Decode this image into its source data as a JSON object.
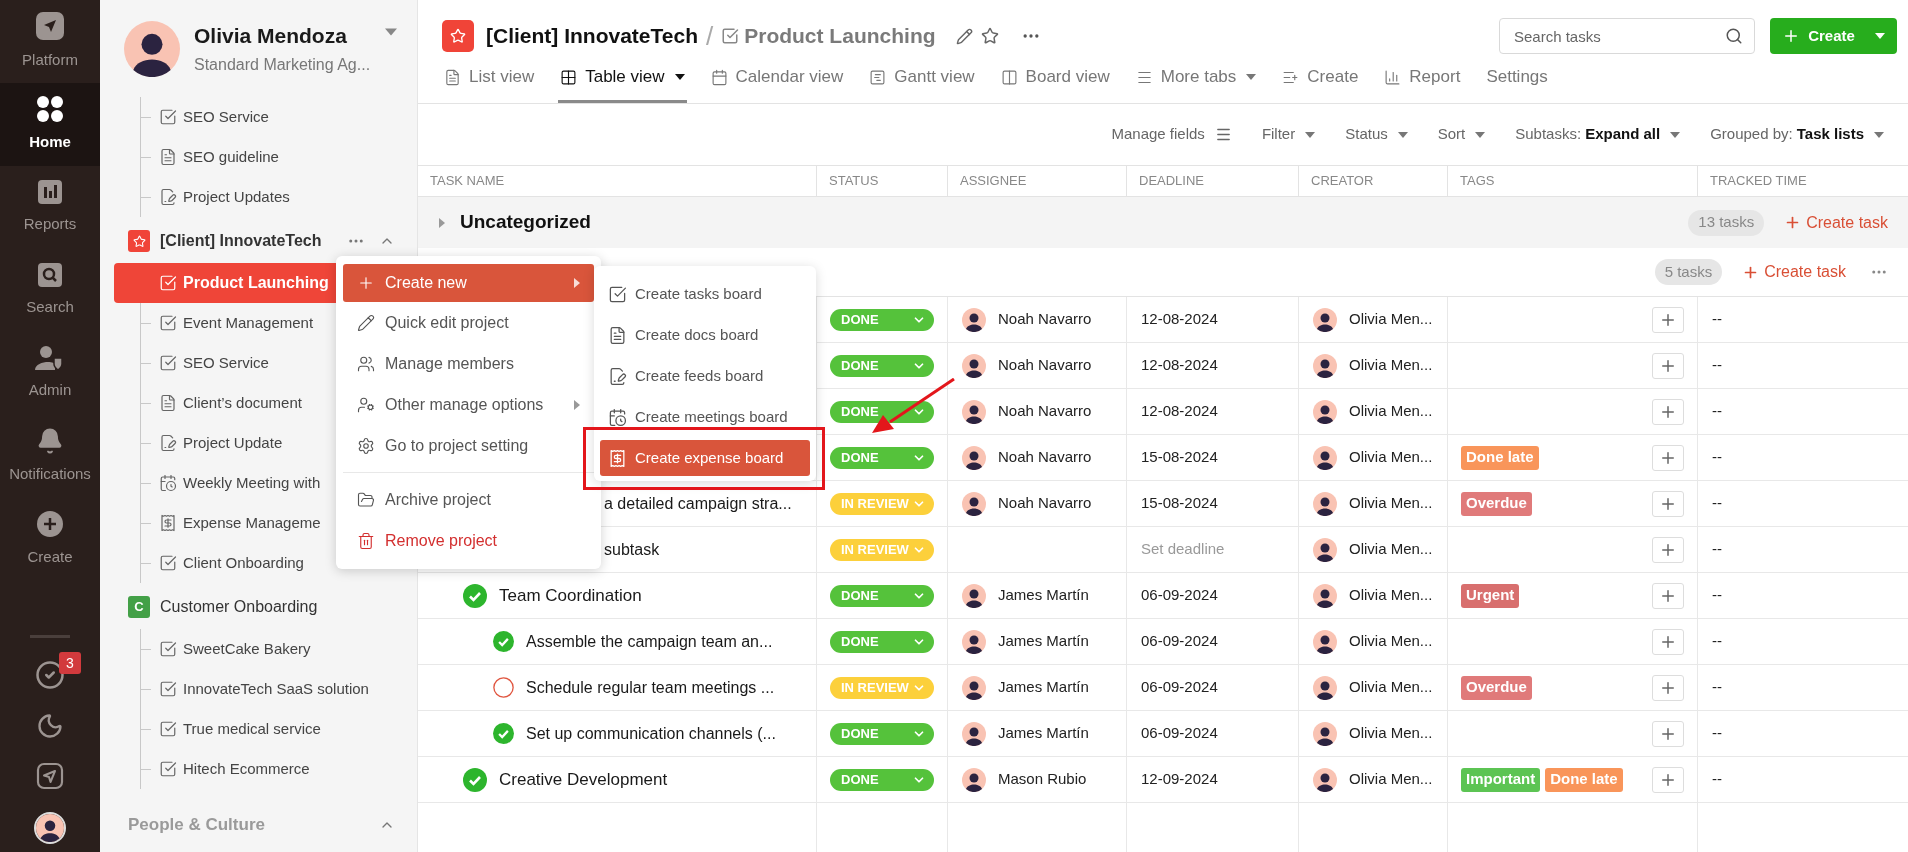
{
  "rail": {
    "items": [
      {
        "label": "Platform",
        "kind": "platform",
        "selected": false
      },
      {
        "label": "Home",
        "kind": "home",
        "selected": true
      },
      {
        "label": "Reports",
        "kind": "reports",
        "selected": false
      },
      {
        "label": "Search",
        "kind": "search",
        "selected": false
      },
      {
        "label": "Admin",
        "kind": "admin",
        "selected": false
      },
      {
        "label": "Notifications",
        "kind": "notifications",
        "selected": false
      },
      {
        "label": "Create",
        "kind": "create",
        "selected": false
      }
    ],
    "tools": [
      {
        "kind": "tasks",
        "badge": "3"
      },
      {
        "kind": "theme"
      },
      {
        "kind": "platform"
      },
      {
        "kind": "avatar"
      }
    ]
  },
  "sidebar": {
    "user": {
      "name": "Olivia Mendoza",
      "subtitle": "Standard Marketing Ag..."
    },
    "groups": [
      {
        "kind": "continued",
        "items": [
          {
            "label": "SEO Service",
            "kind": "tasks",
            "selected": false
          },
          {
            "label": "SEO guideline",
            "kind": "docs",
            "selected": false
          },
          {
            "label": "Project Updates",
            "kind": "feeds",
            "selected": false
          }
        ]
      },
      {
        "kind": "project",
        "name": "[Client] InnovateTech",
        "color": "#f04438",
        "expanded": true,
        "hovered": true,
        "items": [
          {
            "label": "Product Launching",
            "kind": "tasks",
            "selected": true
          },
          {
            "label": "Event Management",
            "kind": "tasks",
            "selected": false
          },
          {
            "label": "SEO Service",
            "kind": "tasks",
            "selected": false
          },
          {
            "label": "Client’s document",
            "kind": "docs",
            "selected": false
          },
          {
            "label": "Project Update",
            "kind": "feeds",
            "selected": false
          },
          {
            "label": "Weekly Meeting with",
            "kind": "meetings",
            "selected": false
          },
          {
            "label": "Expense Manageme",
            "kind": "expense",
            "selected": false
          },
          {
            "label": "Client Onboarding",
            "kind": "tasks",
            "selected": false
          }
        ]
      },
      {
        "kind": "project",
        "name": "Customer Onboarding",
        "letter": "C",
        "color": "#43a047",
        "items": [
          {
            "label": "SweetCake Bakery",
            "kind": "tasks",
            "selected": false
          },
          {
            "label": "InnovateTech SaaS solution",
            "kind": "tasks",
            "selected": false
          },
          {
            "label": "True medical service",
            "kind": "tasks",
            "selected": false
          },
          {
            "label": "Hitech Ecommerce",
            "kind": "tasks",
            "selected": false
          }
        ]
      },
      {
        "kind": "section",
        "name": "People & Culture",
        "expanded": true
      }
    ]
  },
  "header": {
    "project": "[Client] InnovateTech",
    "separator": "/",
    "board": "Product Launching",
    "tabs": [
      {
        "label": "List view",
        "kind": "list",
        "selected": false
      },
      {
        "label": "Table view",
        "kind": "table",
        "selected": true,
        "dropdown": true
      },
      {
        "label": "Calendar view",
        "kind": "calendar",
        "selected": false
      },
      {
        "label": "Gantt view",
        "kind": "gantt",
        "selected": false
      },
      {
        "label": "Board view",
        "kind": "board",
        "selected": false
      },
      {
        "label": "More tabs",
        "kind": "more",
        "selected": false,
        "dropdown": true
      },
      {
        "label": "Create",
        "kind": "create",
        "selected": false
      },
      {
        "label": "Report",
        "kind": "report",
        "selected": false
      },
      {
        "label": "Settings",
        "kind": "settings",
        "selected": false
      }
    ],
    "search": {
      "placeholder": "Search tasks"
    },
    "create_button": "Create"
  },
  "toolbar": [
    {
      "label": "Manage fields",
      "kind": "fields"
    },
    {
      "label": "Filter",
      "kind": "dropdown"
    },
    {
      "label": "Status",
      "kind": "dropdown"
    },
    {
      "label": "Sort",
      "kind": "dropdown"
    },
    {
      "label": "Subtasks:",
      "value": "Expand all",
      "kind": "dropdown"
    },
    {
      "label": "Grouped by:",
      "value": "Task lists",
      "kind": "dropdown"
    }
  ],
  "table": {
    "columns": [
      "TASK NAME",
      "STATUS",
      "ASSIGNEE",
      "DEADLINE",
      "CREATOR",
      "TAGS",
      "TRACKED TIME"
    ],
    "groups": [
      {
        "name": "Uncategorized",
        "expanded": false,
        "count": "13 tasks",
        "action": "Create task"
      },
      {
        "count": "5 tasks",
        "action": "Create task",
        "rows": [
          {
            "status": {
              "label": "DONE",
              "kind": "done"
            },
            "assignee": "Noah Navarro",
            "deadline": "12-08-2024",
            "creator": "Olivia Men...",
            "tracked": "--"
          },
          {
            "status": {
              "label": "DONE",
              "kind": "done"
            },
            "assignee": "Noah Navarro",
            "deadline": "12-08-2024",
            "creator": "Olivia Men...",
            "tracked": "--"
          },
          {
            "status": {
              "label": "DONE",
              "kind": "done"
            },
            "assignee": "Noah Navarro",
            "deadline": "12-08-2024",
            "creator": "Olivia Men...",
            "tracked": "--"
          },
          {
            "status": {
              "label": "DONE",
              "kind": "done"
            },
            "assignee": "Noah Navarro",
            "deadline": "15-08-2024",
            "creator": "Olivia Men...",
            "tags": [
              {
                "label": "Done late",
                "color": "#f9955a"
              }
            ],
            "tracked": "--"
          },
          {
            "name": "a detailed campaign stra...",
            "status": {
              "label": "IN REVIEW",
              "kind": "in_review"
            },
            "assignee": "Noah Navarro",
            "deadline": "15-08-2024",
            "creator": "Olivia Men...",
            "tags": [
              {
                "label": "Overdue",
                "color": "#e07a7a"
              }
            ],
            "tracked": "--"
          },
          {
            "name": "subtask",
            "status": {
              "label": "IN REVIEW",
              "kind": "in_review"
            },
            "deadline_placeholder": "Set deadline",
            "creator": "Olivia Men...",
            "tracked": "--"
          },
          {
            "name": "Team Coordination",
            "done": true,
            "status": {
              "label": "DONE",
              "kind": "done"
            },
            "assignee": "James Martín",
            "deadline": "06-09-2024",
            "creator": "Olivia Men...",
            "tags": [
              {
                "label": "Urgent",
                "color": "#d86f6e"
              }
            ],
            "tracked": "--",
            "children": [
              {
                "name": "Assemble the campaign team an...",
                "done": true,
                "status": {
                  "label": "DONE",
                  "kind": "done"
                },
                "assignee": "James Martín",
                "deadline": "06-09-2024",
                "creator": "Olivia Men...",
                "tracked": "--"
              },
              {
                "name": "Schedule regular team meetings ...",
                "done": false,
                "status": {
                  "label": "IN REVIEW",
                  "kind": "in_review"
                },
                "assignee": "James Martín",
                "deadline": "06-09-2024",
                "creator": "Olivia Men...",
                "tags": [
                  {
                    "label": "Overdue",
                    "color": "#e07a7a"
                  }
                ],
                "tracked": "--"
              },
              {
                "name": "Set up communication channels (...",
                "done": true,
                "status": {
                  "label": "DONE",
                  "kind": "done"
                },
                "assignee": "James Martín",
                "deadline": "06-09-2024",
                "creator": "Olivia Men...",
                "tracked": "--"
              }
            ]
          },
          {
            "name": "Creative Development",
            "done": true,
            "status": {
              "label": "DONE",
              "kind": "done"
            },
            "assignee": "Mason Rubio",
            "deadline": "12-09-2024",
            "creator": "Olivia Men...",
            "tags": [
              {
                "label": "Important",
                "color": "#5cc453"
              },
              {
                "label": "Done late",
                "color": "#f9955a"
              }
            ],
            "tracked": "--"
          }
        ]
      }
    ]
  },
  "context_menu": {
    "groups": [
      [
        {
          "label": "Create new",
          "kind": "create",
          "selected": true,
          "submenu": true
        },
        {
          "label": "Quick edit project",
          "kind": "edit",
          "selected": false
        },
        {
          "label": "Manage members",
          "kind": "members",
          "selected": false
        },
        {
          "label": "Other manage options",
          "kind": "options",
          "selected": false,
          "submenu": true
        },
        {
          "label": "Go to project setting",
          "kind": "settings",
          "selected": false
        }
      ],
      [
        {
          "label": "Archive project",
          "kind": "archive",
          "selected": false
        },
        {
          "label": "Remove project",
          "kind": "remove",
          "selected": false
        }
      ]
    ],
    "submenu": [
      {
        "label": "Create tasks board",
        "kind": "tasks",
        "selected": false
      },
      {
        "label": "Create docs board",
        "kind": "docs",
        "selected": false
      },
      {
        "label": "Create feeds board",
        "kind": "feeds",
        "selected": false
      },
      {
        "label": "Create meetings board",
        "kind": "meetings",
        "selected": false
      },
      {
        "label": "Create expense board",
        "kind": "expense",
        "selected": true,
        "annotated": true
      }
    ]
  }
}
